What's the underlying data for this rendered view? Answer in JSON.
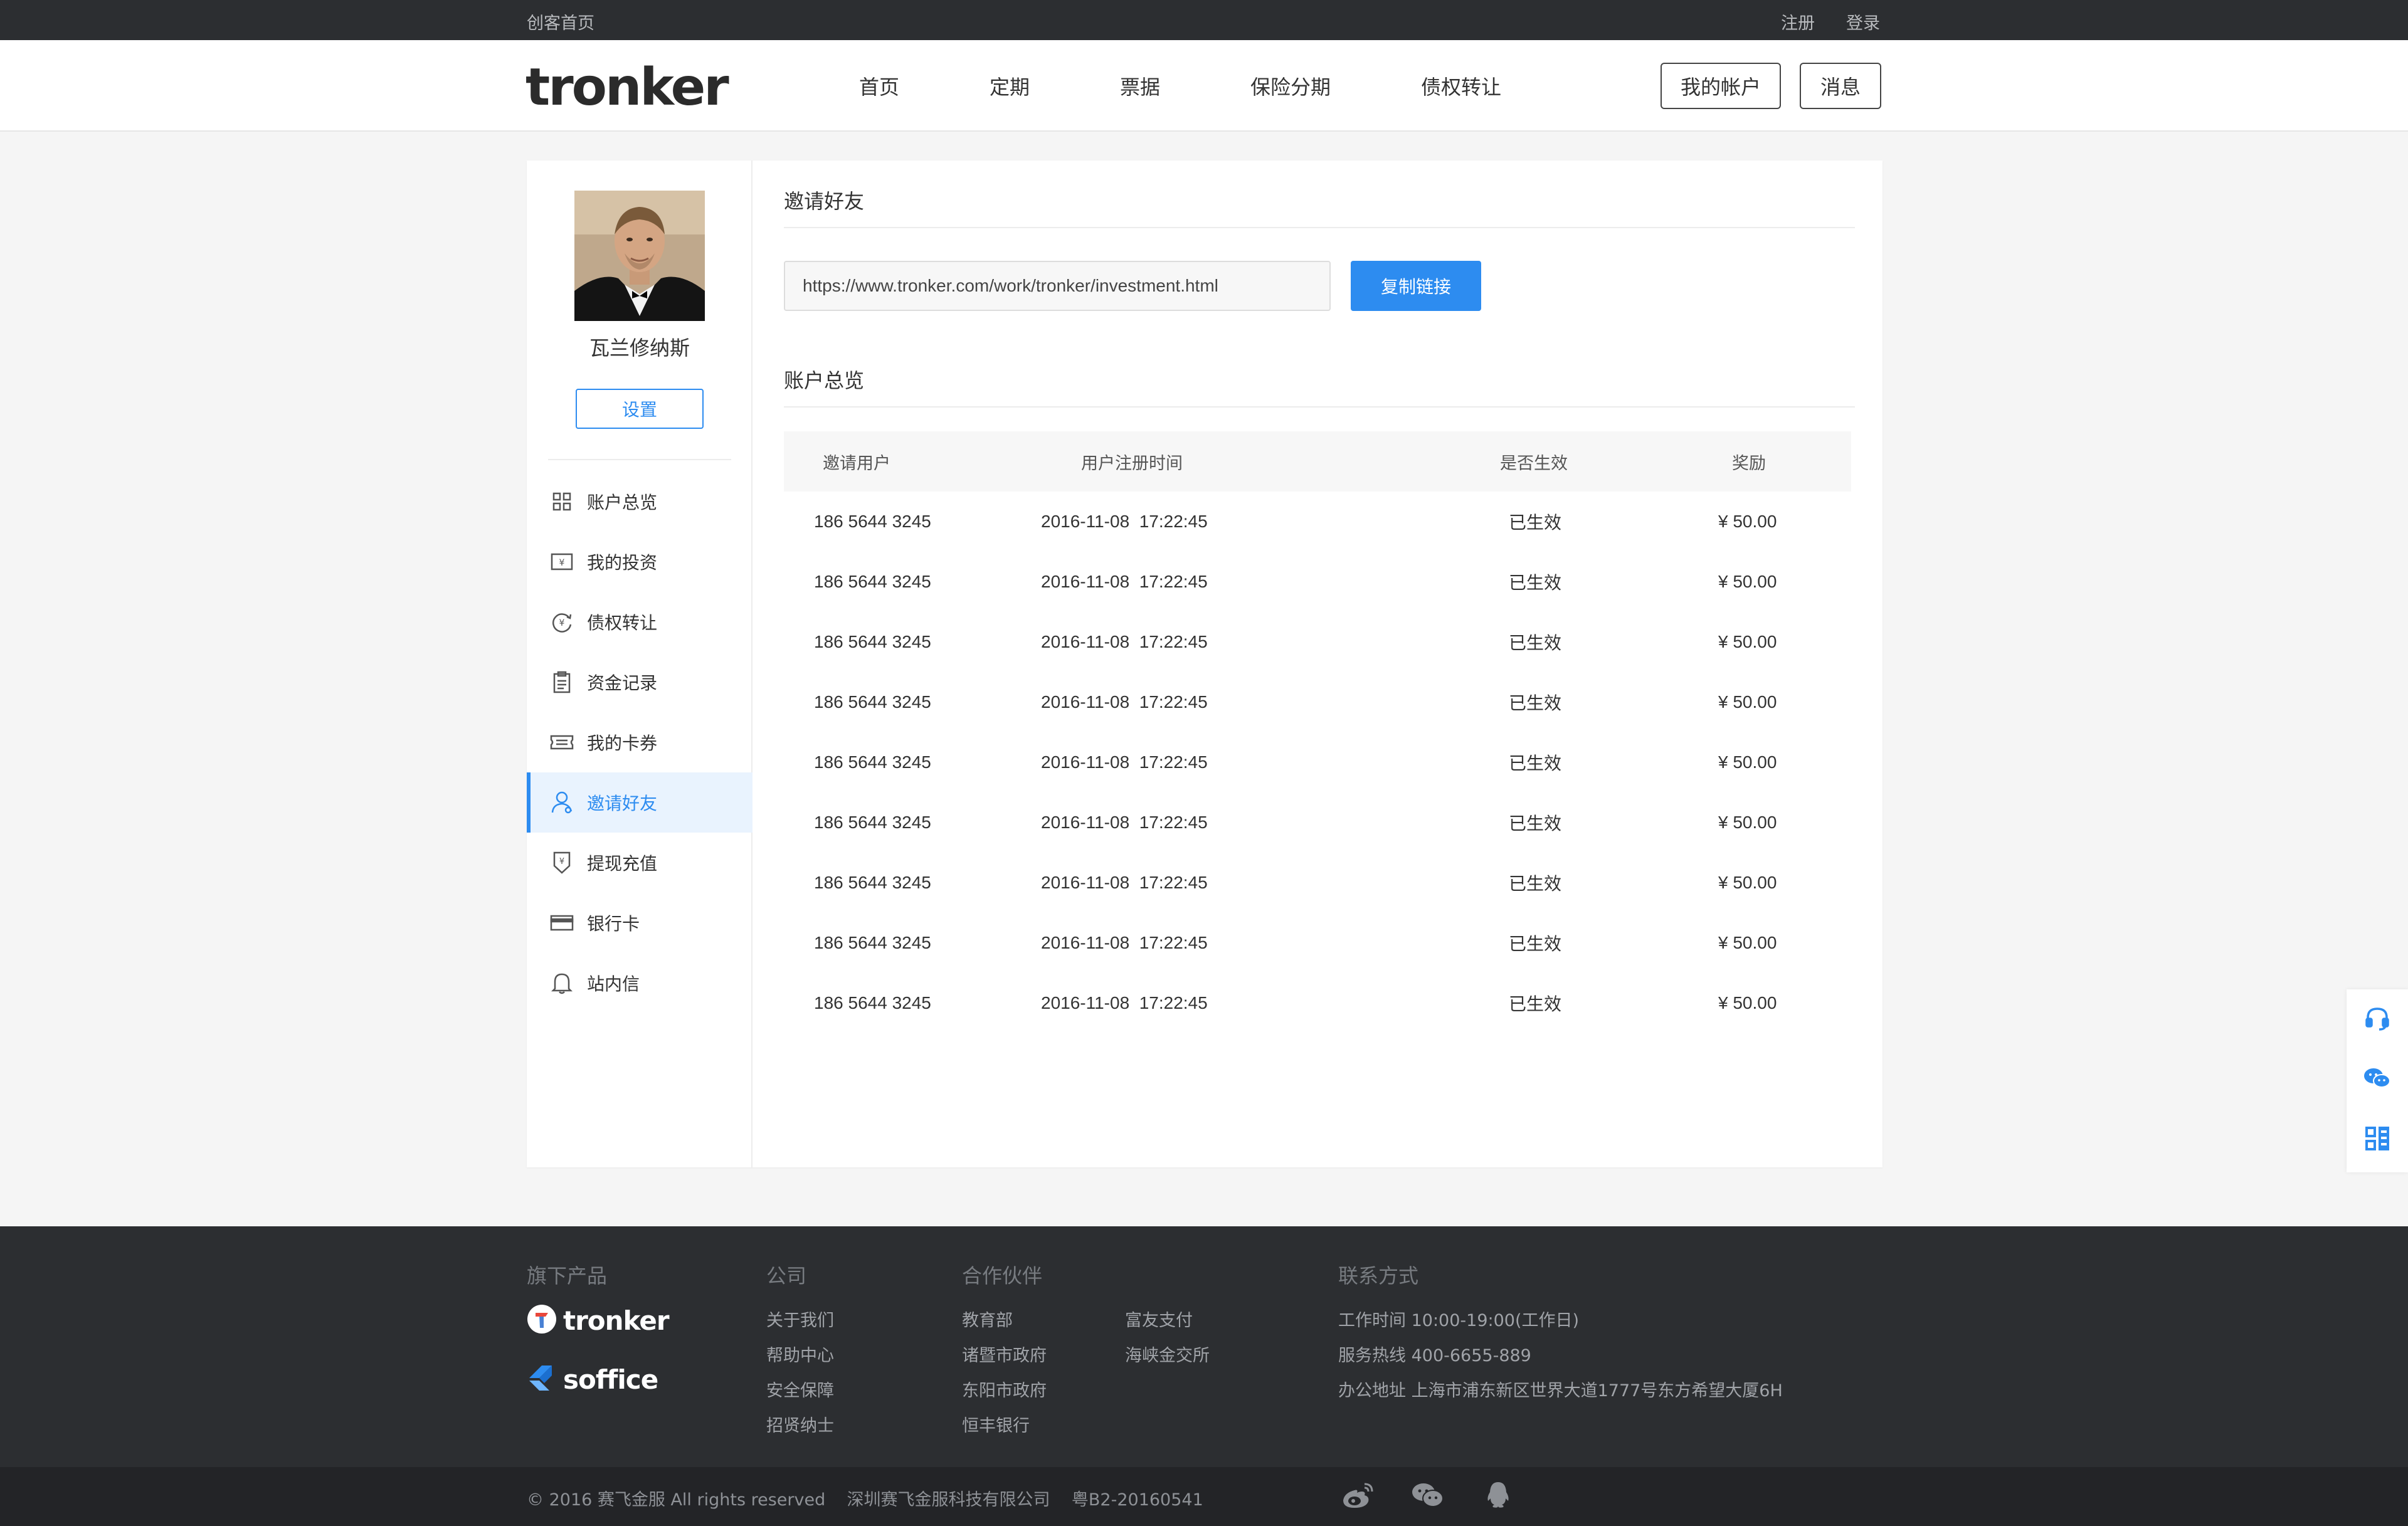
{
  "topbar": {
    "home": "创客首页",
    "register": "注册",
    "login": "登录"
  },
  "header": {
    "logo": "tronker",
    "nav": [
      "首页",
      "定期",
      "票据",
      "保险分期",
      "债权转让"
    ],
    "account_btn": "我的帐户",
    "message_btn": "消息"
  },
  "sidebar": {
    "username": "瓦兰修纳斯",
    "settings": "设置",
    "menu": [
      {
        "label": "账户总览",
        "icon": "grid-icon"
      },
      {
        "label": "我的投资",
        "icon": "yen-box-icon"
      },
      {
        "label": "债权转让",
        "icon": "yen-cycle-icon"
      },
      {
        "label": "资金记录",
        "icon": "clipboard-icon"
      },
      {
        "label": "我的卡券",
        "icon": "ticket-icon"
      },
      {
        "label": "邀请好友",
        "icon": "user-icon",
        "active": true
      },
      {
        "label": "提现充值",
        "icon": "withdraw-icon"
      },
      {
        "label": "银行卡",
        "icon": "card-icon"
      },
      {
        "label": "站内信",
        "icon": "bell-icon"
      }
    ]
  },
  "invite": {
    "title": "邀请好友",
    "link": "https://www.tronker.com/work/tronker/investment.html",
    "copy_btn": "复制链接"
  },
  "overview": {
    "title": "账户总览",
    "columns": [
      "邀请用户",
      "用户注册时间",
      "是否生效",
      "奖励"
    ],
    "rows": [
      [
        "186 5644 3245",
        "2016-11-08  17:22:45",
        "已生效",
        "¥ 50.00"
      ],
      [
        "186 5644 3245",
        "2016-11-08  17:22:45",
        "已生效",
        "¥ 50.00"
      ],
      [
        "186 5644 3245",
        "2016-11-08  17:22:45",
        "已生效",
        "¥ 50.00"
      ],
      [
        "186 5644 3245",
        "2016-11-08  17:22:45",
        "已生效",
        "¥ 50.00"
      ],
      [
        "186 5644 3245",
        "2016-11-08  17:22:45",
        "已生效",
        "¥ 50.00"
      ],
      [
        "186 5644 3245",
        "2016-11-08  17:22:45",
        "已生效",
        "¥ 50.00"
      ],
      [
        "186 5644 3245",
        "2016-11-08  17:22:45",
        "已生效",
        "¥ 50.00"
      ],
      [
        "186 5644 3245",
        "2016-11-08  17:22:45",
        "已生效",
        "¥ 50.00"
      ],
      [
        "186 5644 3245",
        "2016-11-08  17:22:45",
        "已生效",
        "¥ 50.00"
      ]
    ]
  },
  "footer": {
    "products_title": "旗下产品",
    "brands": [
      "tronker",
      "soffice"
    ],
    "company_title": "公司",
    "company_links": [
      "关于我们",
      "帮助中心",
      "安全保障",
      "招贤纳士"
    ],
    "partners_title": "合作伙伴",
    "partners_col1": [
      "教育部",
      "诸暨市政府",
      "东阳市政府",
      "恒丰银行"
    ],
    "partners_col2": [
      "富友支付",
      "海峡金交所"
    ],
    "contact_title": "联系方式",
    "contact": [
      "工作时间  10:00-19:00(工作日)",
      "服务热线  400-6655-889",
      "办公地址  上海市浦东新区世界大道1777号东方希望大厦6H"
    ],
    "copyright": "© 2016 赛飞金服 All rights reserved    深圳赛飞金服科技有限公司    粤B2-20160541"
  },
  "colors": {
    "accent": "#2d8cf0",
    "dark": "#2c2e31",
    "footer_bottom": "#232427"
  }
}
